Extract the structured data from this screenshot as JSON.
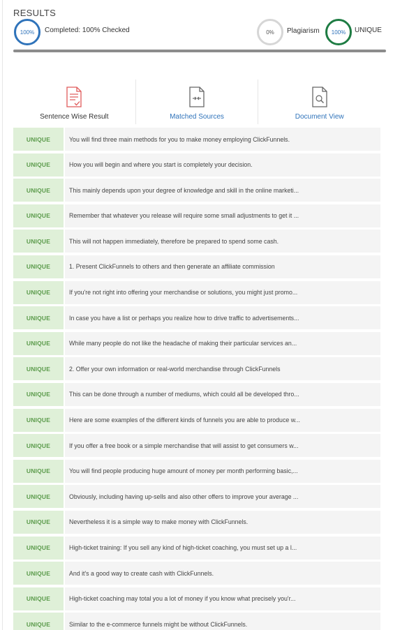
{
  "header": {
    "title": "RESULTS",
    "completed_percent": "100%",
    "completed_text": "Completed: 100% Checked",
    "plagiarism_percent": "0%",
    "plagiarism_label": "Plagiarism",
    "unique_percent": "100%",
    "unique_label": "UNIQUE",
    "progress_value": 1.0
  },
  "colors": {
    "accent_blue": "#2f73ba",
    "unique_green": "#1e7c43",
    "badge_bg": "#dff0d8",
    "badge_text": "#5a9a4a",
    "plag_ring": "#d6d6d6"
  },
  "tabs": [
    {
      "label": "Sentence Wise Result",
      "icon": "document-check-icon"
    },
    {
      "label": "Matched Sources",
      "icon": "compare-file-icon"
    },
    {
      "label": "Document View",
      "icon": "document-search-icon"
    }
  ],
  "rows": [
    {
      "status": "UNIQUE",
      "text": "You will find three main methods for you to make money employing ClickFunnels."
    },
    {
      "status": "UNIQUE",
      "text": "How you will begin and where you start is completely your decision."
    },
    {
      "status": "UNIQUE",
      "text": "This mainly depends upon your degree of knowledge and skill in the online marketi..."
    },
    {
      "status": "UNIQUE",
      "text": "Remember that whatever you release will require some small adjustments to get it ..."
    },
    {
      "status": "UNIQUE",
      "text": "This will not happen immediately, therefore be prepared to spend some cash."
    },
    {
      "status": "UNIQUE",
      "text": "1. Present ClickFunnels to others and then generate an affiliate commission"
    },
    {
      "status": "UNIQUE",
      "text": "If you're not right into offering your merchandise or solutions, you might just promo..."
    },
    {
      "status": "UNIQUE",
      "text": "In case you have a list or perhaps you realize how to drive traffic to advertisements..."
    },
    {
      "status": "UNIQUE",
      "text": "While many people do not like the headache of making their particular services an..."
    },
    {
      "status": "UNIQUE",
      "text": "2. Offer your own information or real-world merchandise through ClickFunnels"
    },
    {
      "status": "UNIQUE",
      "text": "This can be done through a number of mediums, which could all be developed thro..."
    },
    {
      "status": "UNIQUE",
      "text": "Here are some examples of the different kinds of funnels you are able to produce w..."
    },
    {
      "status": "UNIQUE",
      "text": "If you offer a free book or a simple merchandise that will assist to get consumers w..."
    },
    {
      "status": "UNIQUE",
      "text": "You will find people producing huge amount of money per month performing basic,..."
    },
    {
      "status": "UNIQUE",
      "text": "Obviously, including having up-sells and also other offers to improve your average ..."
    },
    {
      "status": "UNIQUE",
      "text": "Nevertheless it is a simple way to make money with ClickFunnels."
    },
    {
      "status": "UNIQUE",
      "text": "High-ticket training: If you sell any kind of high-ticket coaching, you must set up a l..."
    },
    {
      "status": "UNIQUE",
      "text": "And it's a good way to create cash with ClickFunnels."
    },
    {
      "status": "UNIQUE",
      "text": "High-ticket coaching may total you a lot of money if you know what precisely you'r..."
    },
    {
      "status": "UNIQUE",
      "text": "Similar to the e-commerce funnels might be without ClickFunnels."
    }
  ]
}
